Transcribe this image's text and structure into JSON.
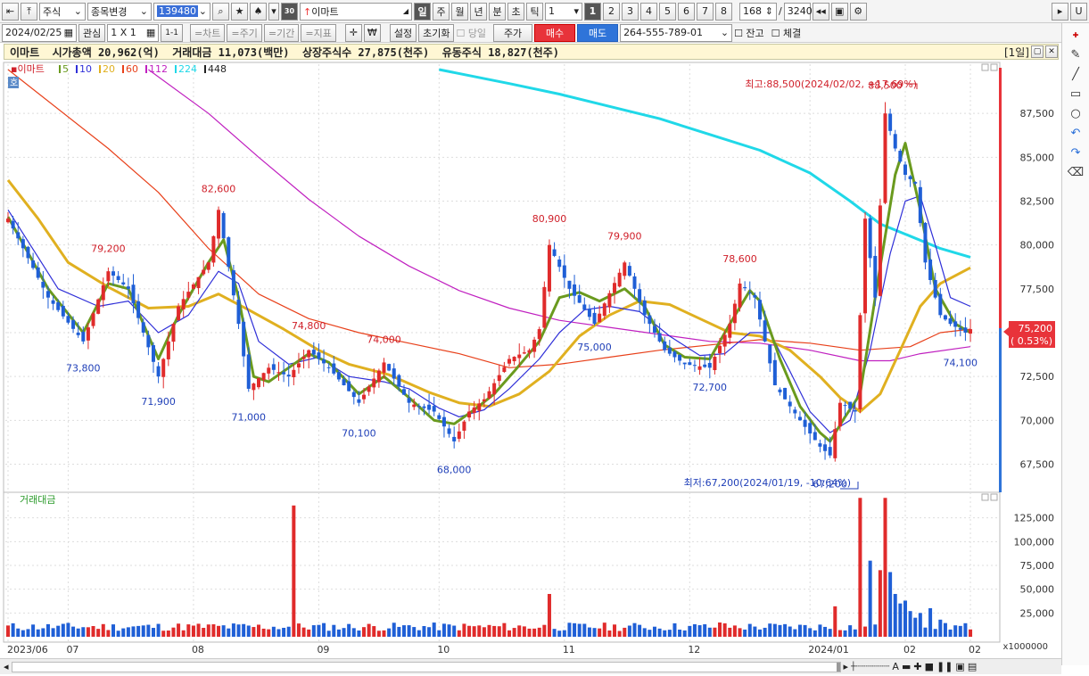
{
  "toolbar": {
    "type_label": "주식",
    "change_label": "종목변경",
    "code": "139480",
    "stock_name": "이마트",
    "period_tabs": [
      "일",
      "주",
      "월",
      "년",
      "분",
      "초",
      "틱"
    ],
    "interval": "1",
    "layout_nums": [
      "1",
      "2",
      "3",
      "4",
      "5",
      "6",
      "7",
      "8"
    ],
    "count": "168",
    "slash": "/",
    "total": "3240",
    "u_label": "U"
  },
  "toolbar2": {
    "date": "2024/02/25",
    "watch_label": "관심",
    "grid": "1 X 1",
    "one_one": "1-1",
    "chart_label": "=차트",
    "cycle_label": "=주기",
    "period_label": "=기간",
    "indicator_label": "=지표",
    "won": "₩",
    "settings_label": "설정",
    "reset_label": "초기화",
    "today_label": "당일",
    "price_label": "주가",
    "buy_label": "매수",
    "sell_label": "매도",
    "account": "264-555-789-01",
    "balance_label": "잔고",
    "fill_label": "체결"
  },
  "info": {
    "text": "이마트  시가총액 20,962(억)  거래대금 11,073(백만)  상장주식수 27,875(천주)  유동주식 18,827(천주)",
    "period": "[1일]"
  },
  "legend": {
    "name": "이마트",
    "mas": [
      {
        "label": "5",
        "color": "#6a9a1e"
      },
      {
        "label": "10",
        "color": "#2f2fd8"
      },
      {
        "label": "20",
        "color": "#e0b020"
      },
      {
        "label": "60",
        "color": "#e8401a"
      },
      {
        "label": "112",
        "color": "#c020c0"
      },
      {
        "label": "224",
        "color": "#20d8e8"
      },
      {
        "label": "448",
        "color": "#222222"
      }
    ],
    "ho": "호",
    "volume_label": "거래대금",
    "volume_unit": "x1000000"
  },
  "chart_data": {
    "type": "candlestick",
    "ylim": [
      66000,
      90000
    ],
    "y_ticks": [
      "87,500",
      "85,000",
      "82,500",
      "80,000",
      "77,500",
      "75,000",
      "72,500",
      "70,000",
      "67,500"
    ],
    "y_tick_values": [
      87500,
      85000,
      82500,
      80000,
      77500,
      75000,
      72500,
      70000,
      67500
    ],
    "x_labels": [
      "2023/06",
      "07",
      "08",
      "09",
      "10",
      "11",
      "12",
      "2024/01",
      "02",
      "02"
    ],
    "high_note": "최고:88,500(2024/02/02, +17.69%)",
    "low_note": "최저:67,200(2024/01/19, -10.64%)",
    "annotations": [
      {
        "label": "79,200",
        "index": 20,
        "value": 79200,
        "place": "above"
      },
      {
        "label": "73,800",
        "index": 15,
        "value": 73800,
        "place": "below"
      },
      {
        "label": "71,900",
        "index": 30,
        "value": 71900,
        "place": "below"
      },
      {
        "label": "82,600",
        "index": 42,
        "value": 82600,
        "place": "above"
      },
      {
        "label": "71,000",
        "index": 48,
        "value": 71000,
        "place": "below"
      },
      {
        "label": "74,800",
        "index": 60,
        "value": 74800,
        "place": "above"
      },
      {
        "label": "70,100",
        "index": 70,
        "value": 70100,
        "place": "below"
      },
      {
        "label": "74,000",
        "index": 75,
        "value": 74000,
        "place": "above"
      },
      {
        "label": "68,000",
        "index": 89,
        "value": 68000,
        "place": "below"
      },
      {
        "label": "80,900",
        "index": 108,
        "value": 80900,
        "place": "above"
      },
      {
        "label": "75,000",
        "index": 117,
        "value": 75000,
        "place": "below"
      },
      {
        "label": "79,900",
        "index": 123,
        "value": 79900,
        "place": "above"
      },
      {
        "label": "72,700",
        "index": 140,
        "value": 72700,
        "place": "below"
      },
      {
        "label": "78,600",
        "index": 146,
        "value": 78600,
        "place": "above"
      },
      {
        "label": "67,200",
        "index": 164,
        "value": 67200,
        "place": "below"
      },
      {
        "label": "88,500",
        "index": 175,
        "value": 88500,
        "place": "above"
      },
      {
        "label": "74,100",
        "index": 190,
        "value": 74100,
        "place": "below"
      }
    ],
    "current_price": "75,200",
    "current_change": "( 0.53%)",
    "last_value": 75200,
    "key_points": [
      [
        0,
        81500
      ],
      [
        8,
        77000
      ],
      [
        15,
        74500
      ],
      [
        20,
        78500
      ],
      [
        24,
        77500
      ],
      [
        30,
        72500
      ],
      [
        34,
        76500
      ],
      [
        40,
        79000
      ],
      [
        42,
        82000
      ],
      [
        46,
        75500
      ],
      [
        48,
        71800
      ],
      [
        52,
        73000
      ],
      [
        56,
        72500
      ],
      [
        60,
        74000
      ],
      [
        64,
        73000
      ],
      [
        70,
        71000
      ],
      [
        75,
        73300
      ],
      [
        80,
        71000
      ],
      [
        85,
        70500
      ],
      [
        89,
        68800
      ],
      [
        92,
        70500
      ],
      [
        95,
        71200
      ],
      [
        100,
        73500
      ],
      [
        104,
        74000
      ],
      [
        106,
        75200
      ],
      [
        108,
        80000
      ],
      [
        112,
        77500
      ],
      [
        117,
        75500
      ],
      [
        123,
        79000
      ],
      [
        127,
        76000
      ],
      [
        131,
        74000
      ],
      [
        135,
        73200
      ],
      [
        140,
        73000
      ],
      [
        144,
        75500
      ],
      [
        146,
        77800
      ],
      [
        149,
        77000
      ],
      [
        153,
        72000
      ],
      [
        158,
        70000
      ],
      [
        162,
        68500
      ],
      [
        164,
        68000
      ],
      [
        166,
        71000
      ],
      [
        169,
        70500
      ],
      [
        171,
        81500
      ],
      [
        173,
        77000
      ],
      [
        175,
        87500
      ],
      [
        177,
        85500
      ],
      [
        179,
        84000
      ],
      [
        181,
        83500
      ],
      [
        183,
        79000
      ],
      [
        186,
        76000
      ],
      [
        188,
        75500
      ],
      [
        191,
        75000
      ],
      [
        192,
        75200
      ]
    ],
    "ma_points": {
      "ma5": [
        [
          0,
          81600
        ],
        [
          8,
          77500
        ],
        [
          15,
          75000
        ],
        [
          20,
          77800
        ],
        [
          24,
          77500
        ],
        [
          30,
          73500
        ],
        [
          34,
          76000
        ],
        [
          40,
          79000
        ],
        [
          43,
          80300
        ],
        [
          46,
          77000
        ],
        [
          49,
          72500
        ],
        [
          52,
          72200
        ],
        [
          56,
          73000
        ],
        [
          60,
          73800
        ],
        [
          64,
          73300
        ],
        [
          70,
          71500
        ],
        [
          75,
          72500
        ],
        [
          80,
          71300
        ],
        [
          85,
          70000
        ],
        [
          89,
          69800
        ],
        [
          93,
          70600
        ],
        [
          97,
          71500
        ],
        [
          101,
          72800
        ],
        [
          106,
          74500
        ],
        [
          110,
          77000
        ],
        [
          114,
          77300
        ],
        [
          118,
          76800
        ],
        [
          123,
          77500
        ],
        [
          127,
          76500
        ],
        [
          131,
          74300
        ],
        [
          135,
          73600
        ],
        [
          140,
          73500
        ],
        [
          144,
          75500
        ],
        [
          148,
          77400
        ],
        [
          150,
          76800
        ],
        [
          154,
          73500
        ],
        [
          158,
          70800
        ],
        [
          162,
          69300
        ],
        [
          164,
          68800
        ],
        [
          167,
          70200
        ],
        [
          170,
          71500
        ],
        [
          173,
          77000
        ],
        [
          177,
          84000
        ],
        [
          179,
          85800
        ],
        [
          182,
          82000
        ],
        [
          185,
          77500
        ],
        [
          189,
          75500
        ],
        [
          192,
          75000
        ]
      ],
      "ma10": [
        [
          0,
          82000
        ],
        [
          10,
          77500
        ],
        [
          18,
          76500
        ],
        [
          24,
          76800
        ],
        [
          30,
          75000
        ],
        [
          36,
          76000
        ],
        [
          42,
          78500
        ],
        [
          46,
          77800
        ],
        [
          50,
          74500
        ],
        [
          56,
          73200
        ],
        [
          62,
          73600
        ],
        [
          68,
          72500
        ],
        [
          75,
          72200
        ],
        [
          80,
          71800
        ],
        [
          86,
          70700
        ],
        [
          90,
          70200
        ],
        [
          95,
          70600
        ],
        [
          100,
          71800
        ],
        [
          106,
          73500
        ],
        [
          110,
          75000
        ],
        [
          115,
          76300
        ],
        [
          120,
          76500
        ],
        [
          126,
          76200
        ],
        [
          132,
          74800
        ],
        [
          138,
          73700
        ],
        [
          143,
          73800
        ],
        [
          148,
          75000
        ],
        [
          152,
          75000
        ],
        [
          156,
          72800
        ],
        [
          160,
          70500
        ],
        [
          164,
          69300
        ],
        [
          168,
          70000
        ],
        [
          172,
          74000
        ],
        [
          176,
          79500
        ],
        [
          179,
          82500
        ],
        [
          182,
          82800
        ],
        [
          185,
          80000
        ],
        [
          188,
          77000
        ],
        [
          192,
          76500
        ]
      ],
      "ma20": [
        [
          0,
          83700
        ],
        [
          6,
          81500
        ],
        [
          12,
          79000
        ],
        [
          20,
          77600
        ],
        [
          28,
          76400
        ],
        [
          36,
          76500
        ],
        [
          42,
          77200
        ],
        [
          48,
          76300
        ],
        [
          55,
          75200
        ],
        [
          62,
          74000
        ],
        [
          68,
          73200
        ],
        [
          76,
          72600
        ],
        [
          84,
          71600
        ],
        [
          90,
          71000
        ],
        [
          96,
          70800
        ],
        [
          102,
          71500
        ],
        [
          108,
          72800
        ],
        [
          114,
          74800
        ],
        [
          120,
          76000
        ],
        [
          126,
          76800
        ],
        [
          132,
          76600
        ],
        [
          138,
          75800
        ],
        [
          144,
          75000
        ],
        [
          150,
          74800
        ],
        [
          156,
          74000
        ],
        [
          162,
          72500
        ],
        [
          166,
          71300
        ],
        [
          170,
          70500
        ],
        [
          174,
          71500
        ],
        [
          178,
          74000
        ],
        [
          182,
          76500
        ],
        [
          186,
          77800
        ],
        [
          192,
          78700
        ]
      ],
      "ma60": [
        [
          0,
          90000
        ],
        [
          20,
          85500
        ],
        [
          30,
          83000
        ],
        [
          40,
          79800
        ],
        [
          50,
          77200
        ],
        [
          60,
          75800
        ],
        [
          70,
          75000
        ],
        [
          80,
          74400
        ],
        [
          90,
          73800
        ],
        [
          100,
          73000
        ],
        [
          110,
          73200
        ],
        [
          120,
          73600
        ],
        [
          130,
          74000
        ],
        [
          140,
          74300
        ],
        [
          150,
          74600
        ],
        [
          160,
          74400
        ],
        [
          170,
          74000
        ],
        [
          180,
          74200
        ],
        [
          186,
          75000
        ],
        [
          192,
          75200
        ]
      ],
      "ma112": [
        [
          28,
          90000
        ],
        [
          40,
          87500
        ],
        [
          50,
          85000
        ],
        [
          60,
          82600
        ],
        [
          70,
          80500
        ],
        [
          80,
          78800
        ],
        [
          90,
          77400
        ],
        [
          100,
          76400
        ],
        [
          110,
          75700
        ],
        [
          120,
          75300
        ],
        [
          130,
          74900
        ],
        [
          140,
          74500
        ],
        [
          150,
          74400
        ],
        [
          160,
          74000
        ],
        [
          170,
          73400
        ],
        [
          176,
          73400
        ],
        [
          182,
          73800
        ],
        [
          192,
          74200
        ]
      ],
      "ma224": [
        [
          86,
          90000
        ],
        [
          100,
          89200
        ],
        [
          110,
          88600
        ],
        [
          120,
          87900
        ],
        [
          130,
          87200
        ],
        [
          140,
          86300
        ],
        [
          150,
          85400
        ],
        [
          160,
          84100
        ],
        [
          168,
          82500
        ],
        [
          174,
          81200
        ],
        [
          180,
          80500
        ],
        [
          186,
          79800
        ],
        [
          192,
          79300
        ]
      ]
    },
    "volume_ticks": [
      "125,000",
      "100,000",
      "75,000",
      "50,000",
      "25,000"
    ],
    "volume_tick_values": [
      125000,
      100000,
      75000,
      50000,
      25000
    ],
    "volume_max": 150000,
    "volume_spikes": [
      [
        57,
        138000
      ],
      [
        108,
        45000
      ],
      [
        142,
        15000
      ],
      [
        165,
        32000
      ],
      [
        170,
        146000
      ],
      [
        172,
        80000
      ],
      [
        174,
        70000
      ],
      [
        175,
        146000
      ],
      [
        176,
        68000
      ],
      [
        177,
        45000
      ],
      [
        178,
        35000
      ],
      [
        179,
        38000
      ],
      [
        180,
        27000
      ],
      [
        181,
        20000
      ],
      [
        182,
        25000
      ],
      [
        184,
        30000
      ],
      [
        186,
        18000
      ]
    ]
  }
}
